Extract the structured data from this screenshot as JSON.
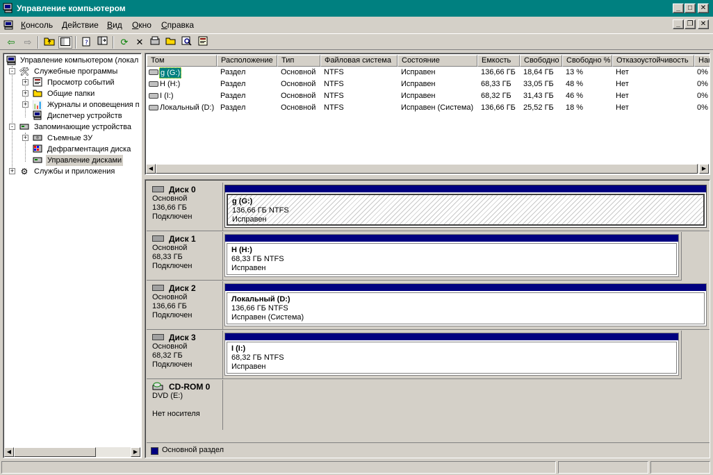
{
  "window": {
    "title": "Управление компьютером",
    "buttons": {
      "minimize": "_",
      "maximize": "□",
      "close": "✕"
    }
  },
  "menu": {
    "items": [
      "Консоль",
      "Действие",
      "Вид",
      "Окно",
      "Справка"
    ],
    "mdi_buttons": {
      "minimize": "_",
      "restore": "❐",
      "close": "✕"
    }
  },
  "toolbar": {
    "icons": [
      "back-icon",
      "forward-icon",
      "up-folder-icon",
      "show-hide-tree-icon",
      "properties-icon",
      "export-list-icon",
      "refresh-icon",
      "delete-icon",
      "disk-properties-icon",
      "open-icon",
      "search-icon",
      "help-icon"
    ]
  },
  "tree": {
    "root": "Управление компьютером (локал",
    "items": [
      {
        "label": "Служебные программы",
        "level": 1,
        "expander": "-"
      },
      {
        "label": "Просмотр событий",
        "level": 2,
        "expander": "+"
      },
      {
        "label": "Общие папки",
        "level": 2,
        "expander": "+"
      },
      {
        "label": "Журналы и оповещения п",
        "level": 2,
        "expander": "+"
      },
      {
        "label": "Диспетчер устройств",
        "level": 2,
        "expander": ""
      },
      {
        "label": "Запоминающие устройства",
        "level": 1,
        "expander": "-"
      },
      {
        "label": "Съемные ЗУ",
        "level": 2,
        "expander": "+"
      },
      {
        "label": "Дефрагментация диска",
        "level": 2,
        "expander": ""
      },
      {
        "label": "Управление дисками",
        "level": 2,
        "expander": "",
        "selected": true
      },
      {
        "label": "Службы и приложения",
        "level": 1,
        "expander": "+"
      }
    ]
  },
  "volume_list": {
    "columns": [
      "Том",
      "Расположение",
      "Тип",
      "Файловая система",
      "Состояние",
      "Емкость",
      "Свободно",
      "Свободно %",
      "Отказоустойчивость",
      "Накладные расходы"
    ],
    "rows": [
      [
        "g (G:)",
        "Раздел",
        "Основной",
        "NTFS",
        "Исправен",
        "136,66 ГБ",
        "18,64 ГБ",
        "13 %",
        "Нет",
        "0%"
      ],
      [
        "H (H:)",
        "Раздел",
        "Основной",
        "NTFS",
        "Исправен",
        "68,33 ГБ",
        "33,05 ГБ",
        "48 %",
        "Нет",
        "0%"
      ],
      [
        "I (I:)",
        "Раздел",
        "Основной",
        "NTFS",
        "Исправен",
        "68,32 ГБ",
        "31,43 ГБ",
        "46 %",
        "Нет",
        "0%"
      ],
      [
        "Локальный (D:)",
        "Раздел",
        "Основной",
        "NTFS",
        "Исправен (Система)",
        "136,66 ГБ",
        "25,52 ГБ",
        "18 %",
        "Нет",
        "0%"
      ]
    ],
    "column_header_visible": [
      "Том",
      "Расположение",
      "Тип",
      "Файловая система",
      "Состояние",
      "Емкость",
      "Свободно",
      "Свободно %",
      "Отказоустойчивость",
      "Нак"
    ]
  },
  "disks": [
    {
      "name": "Диск 0",
      "type": "Основной",
      "size": "136,66 ГБ",
      "status": "Подключен",
      "partition": {
        "label": "g  (G:)",
        "detail": "136,66 ГБ NTFS",
        "state": "Исправен",
        "selected": true
      }
    },
    {
      "name": "Диск 1",
      "type": "Основной",
      "size": "68,33 ГБ",
      "status": "Подключен",
      "partition": {
        "label": "H  (H:)",
        "detail": "68,33 ГБ NTFS",
        "state": "Исправен"
      }
    },
    {
      "name": "Диск 2",
      "type": "Основной",
      "size": "136,66 ГБ",
      "status": "Подключен",
      "partition": {
        "label": "Локальный  (D:)",
        "detail": "136,66 ГБ NTFS",
        "state": "Исправен (Система)"
      }
    },
    {
      "name": "Диск 3",
      "type": "Основной",
      "size": "68,32 ГБ",
      "status": "Подключен",
      "partition": {
        "label": "I  (I:)",
        "detail": "68,32 ГБ NTFS",
        "state": "Исправен"
      }
    }
  ],
  "cdrom": {
    "name": "CD-ROM 0",
    "drive": "DVD (E:)",
    "status": "Нет носителя"
  },
  "legend": {
    "label": "Основной раздел",
    "color": "#000080"
  },
  "colors": {
    "titlebar": "#008080",
    "primary_partition": "#000080",
    "face": "#d4d0c8"
  }
}
